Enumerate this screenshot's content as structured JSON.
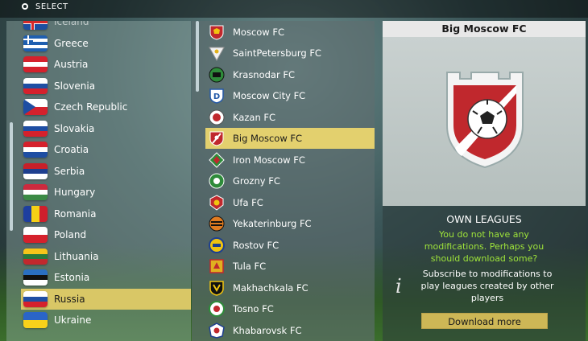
{
  "topbar": {
    "label": "SELECT"
  },
  "countries": [
    {
      "name": "Iceland",
      "flag": "iceland"
    },
    {
      "name": "Greece",
      "flag": "greece"
    },
    {
      "name": "Austria",
      "flag": "austria"
    },
    {
      "name": "Slovenia",
      "flag": "slovenia"
    },
    {
      "name": "Czech Republic",
      "flag": "czech"
    },
    {
      "name": "Slovakia",
      "flag": "slovakia"
    },
    {
      "name": "Croatia",
      "flag": "croatia"
    },
    {
      "name": "Serbia",
      "flag": "serbia"
    },
    {
      "name": "Hungary",
      "flag": "hungary"
    },
    {
      "name": "Romania",
      "flag": "romania"
    },
    {
      "name": "Poland",
      "flag": "poland"
    },
    {
      "name": "Lithuania",
      "flag": "lithuania"
    },
    {
      "name": "Estonia",
      "flag": "estonia"
    },
    {
      "name": "Russia",
      "flag": "russia",
      "selected": true
    },
    {
      "name": "Ukraine",
      "flag": "ukraine"
    }
  ],
  "clubs": [
    {
      "name": "Moscow FC",
      "crest": "shield-icon",
      "color": "#c0282d"
    },
    {
      "name": "SaintPetersburg FC",
      "crest": "shield-icon",
      "color": "#e8e8e8"
    },
    {
      "name": "Krasnodar FC",
      "crest": "shield-icon",
      "color": "#2e8b3a"
    },
    {
      "name": "Moscow City FC",
      "crest": "shield-icon",
      "color": "#2459a8"
    },
    {
      "name": "Kazan FC",
      "crest": "shield-icon",
      "color": "#c0282d"
    },
    {
      "name": "Big Moscow FC",
      "crest": "shield-icon",
      "color": "#c0282d",
      "selected": true
    },
    {
      "name": "Iron Moscow FC",
      "crest": "shield-icon",
      "color": "#2e8b3a"
    },
    {
      "name": "Grozny FC",
      "crest": "shield-icon",
      "color": "#2e8b3a"
    },
    {
      "name": "Ufa FC",
      "crest": "shield-icon",
      "color": "#c0282d"
    },
    {
      "name": "Yekaterinburg FC",
      "crest": "shield-icon",
      "color": "#e07b20"
    },
    {
      "name": "Rostov FC",
      "crest": "shield-icon",
      "color": "#f1c40f"
    },
    {
      "name": "Tula FC",
      "crest": "shield-icon",
      "color": "#e0b020"
    },
    {
      "name": "Makhachkala FC",
      "crest": "shield-icon",
      "color": "#f1c40f"
    },
    {
      "name": "Tosno FC",
      "crest": "shield-icon",
      "color": "#2e8b3a"
    },
    {
      "name": "Khabarovsk FC",
      "crest": "shield-icon",
      "color": "#c0282d"
    }
  ],
  "panel": {
    "title": "Big Moscow FC",
    "own_title": "OWN LEAGUES",
    "own_msg": "You do not have any modifications. Perhaps you should download some?",
    "sub_text": "Subscribe to modifications to play leagues created by other players",
    "download_label": "Download more",
    "info_icon": "info-icon"
  },
  "colors": {
    "selected_bg": "#d9c766",
    "message_green": "#9ee33a",
    "button_bg": "#cdb756"
  }
}
